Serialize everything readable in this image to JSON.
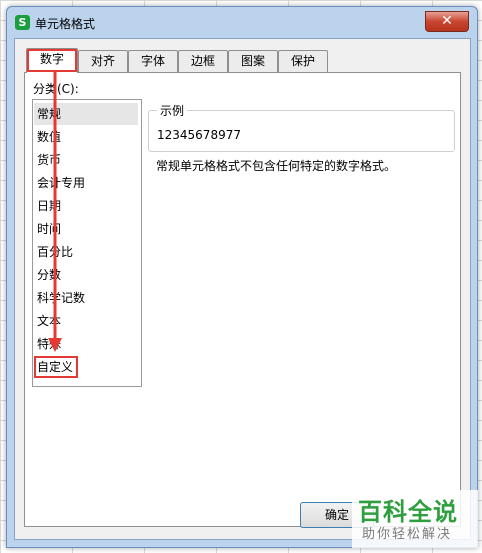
{
  "window": {
    "title": "单元格格式",
    "app_icon": "S",
    "close_label": "✕"
  },
  "tabs": [
    {
      "label": "数字",
      "active": true
    },
    {
      "label": "对齐",
      "active": false
    },
    {
      "label": "字体",
      "active": false
    },
    {
      "label": "边框",
      "active": false
    },
    {
      "label": "图案",
      "active": false
    },
    {
      "label": "保护",
      "active": false
    }
  ],
  "category": {
    "label": "分类(C):",
    "items": [
      "常规",
      "数值",
      "货币",
      "会计专用",
      "日期",
      "时间",
      "百分比",
      "分数",
      "科学记数",
      "文本",
      "特殊",
      "自定义"
    ],
    "selected": "常规",
    "highlighted": "自定义"
  },
  "sample": {
    "label": "示例",
    "value": "12345678977"
  },
  "description": "常规单元格格式不包含任何特定的数字格式。",
  "buttons": {
    "ok": "确定"
  },
  "watermark": {
    "main": "百科全说",
    "sub": "助你轻松解决"
  },
  "colors": {
    "annotation_red": "#e53935",
    "watermark_green": "#2e9e3e"
  }
}
